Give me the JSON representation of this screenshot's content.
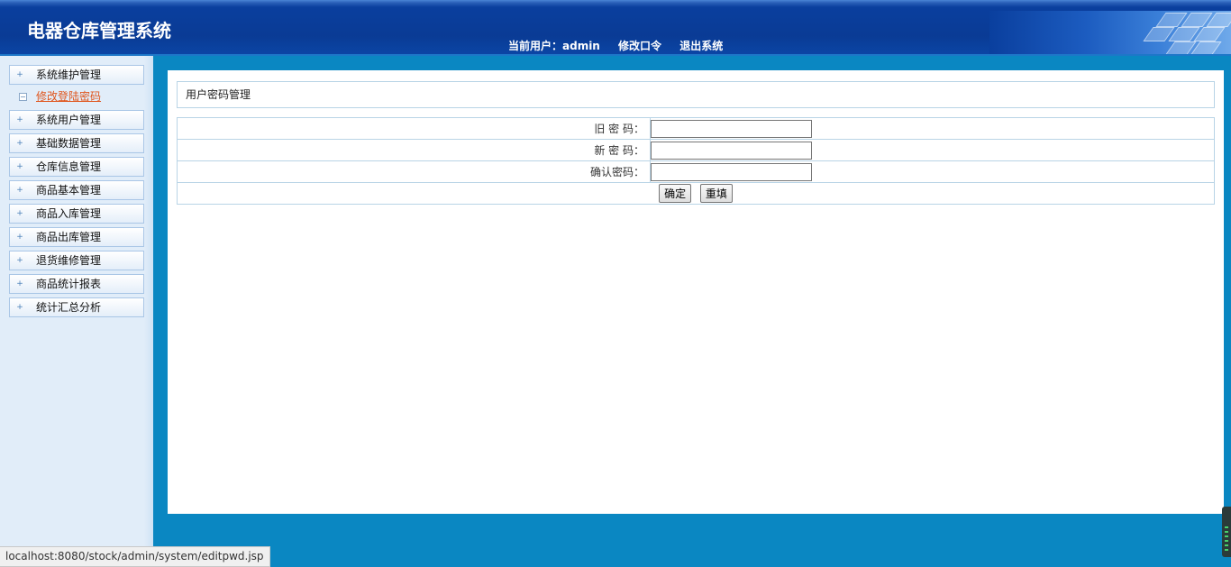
{
  "header": {
    "title": "电器仓库管理系统",
    "current_user_label": "当前用户：admin",
    "change_password_label": "修改口令",
    "logout_label": "退出系统"
  },
  "sidebar": {
    "items": [
      {
        "label": "系统维护管理"
      },
      {
        "label": "修改登陆密码",
        "active": true
      },
      {
        "label": "系统用户管理"
      },
      {
        "label": "基础数据管理"
      },
      {
        "label": "仓库信息管理"
      },
      {
        "label": "商品基本管理"
      },
      {
        "label": "商品入库管理"
      },
      {
        "label": "商品出库管理"
      },
      {
        "label": "退货维修管理"
      },
      {
        "label": "商品统计报表"
      },
      {
        "label": "统计汇总分析"
      }
    ]
  },
  "main": {
    "section_title": "用户密码管理",
    "form": {
      "old_password_label": "旧 密 码：",
      "new_password_label": "新 密 码：",
      "confirm_password_label": "确认密码：",
      "old_password_value": "",
      "new_password_value": "",
      "confirm_password_value": "",
      "submit_label": "确定",
      "reset_label": "重填"
    }
  },
  "statusbar": {
    "url": "localhost:8080/stock/admin/system/editpwd.jsp"
  },
  "colors": {
    "page_background": "#0a87c2",
    "header_blue": "#0a3b95",
    "sidebar_background": "#e1edf9",
    "active_link": "#e0551c"
  }
}
